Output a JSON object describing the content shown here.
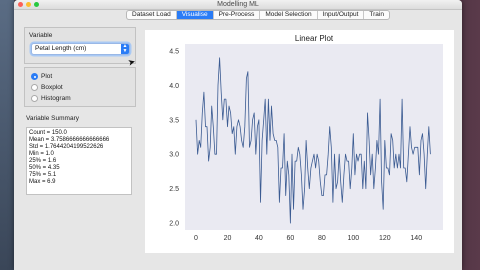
{
  "window": {
    "title": "Modelling ML"
  },
  "tabs": [
    {
      "label": "Dataset Load",
      "active": false
    },
    {
      "label": "Visualise",
      "active": true
    },
    {
      "label": "Pre-Process",
      "active": false
    },
    {
      "label": "Model Selection",
      "active": false
    },
    {
      "label": "Input/Output",
      "active": false
    },
    {
      "label": "Train",
      "active": false
    }
  ],
  "variable": {
    "label": "Variable",
    "selected": "Petal Length (cm)"
  },
  "plot_types": [
    {
      "label": "Plot",
      "checked": true
    },
    {
      "label": "Boxplot",
      "checked": false
    },
    {
      "label": "Histogram",
      "checked": false
    }
  ],
  "summary": {
    "label": "Variable Summary",
    "lines": [
      "Count = 150.0",
      "Mean = 3.7586666666666666",
      "Std = 1.764420419952262​6",
      "Min = 1.0",
      "25% = 1.6",
      "50% = 4.35",
      "75% = 5.1",
      "Max = 6.9"
    ]
  },
  "chart_data": {
    "type": "line",
    "title": "Linear Plot",
    "xlabel": "",
    "ylabel": "",
    "xlim": [
      -7,
      157
    ],
    "ylim": [
      1.9,
      4.6
    ],
    "xticks": [
      0,
      20,
      40,
      60,
      80,
      100,
      120,
      140
    ],
    "yticks": [
      2.0,
      2.5,
      3.0,
      3.5,
      4.0,
      4.5
    ],
    "grid": false,
    "color": "#3b5b92",
    "background": "#eaeaf2",
    "series": [
      {
        "values": [
          3.5,
          3.0,
          3.2,
          3.1,
          3.6,
          3.9,
          3.4,
          3.4,
          2.9,
          3.1,
          3.7,
          3.4,
          3.0,
          3.0,
          4.0,
          4.4,
          3.9,
          3.5,
          3.8,
          3.8,
          3.4,
          3.7,
          3.6,
          3.3,
          3.4,
          3.0,
          3.4,
          3.5,
          3.4,
          3.2,
          3.1,
          3.4,
          4.1,
          4.2,
          3.1,
          3.2,
          3.5,
          3.6,
          3.0,
          3.4,
          3.5,
          2.3,
          3.2,
          3.5,
          3.8,
          3.0,
          3.8,
          3.2,
          3.7,
          3.3,
          3.2,
          3.2,
          3.1,
          2.3,
          2.8,
          2.8,
          3.3,
          2.4,
          2.9,
          2.7,
          2.0,
          3.0,
          2.2,
          2.9,
          2.9,
          3.1,
          3.0,
          2.7,
          2.2,
          2.5,
          3.2,
          2.8,
          2.5,
          2.8,
          2.9,
          3.0,
          2.8,
          3.0,
          2.9,
          2.6,
          2.4,
          2.4,
          2.7,
          2.7,
          3.0,
          3.4,
          3.1,
          2.3,
          3.0,
          2.5,
          2.6,
          3.0,
          2.6,
          2.3,
          2.7,
          3.0,
          2.9,
          2.9,
          2.5,
          2.8,
          3.3,
          2.7,
          3.0,
          2.9,
          3.0,
          3.0,
          2.5,
          2.9,
          2.5,
          3.6,
          3.2,
          2.7,
          3.0,
          2.5,
          2.8,
          3.2,
          3.0,
          3.8,
          2.6,
          2.2,
          3.2,
          2.8,
          2.8,
          2.7,
          3.3,
          3.2,
          2.8,
          3.0,
          2.8,
          3.0,
          2.8,
          3.8,
          2.8,
          2.8,
          2.6,
          3.0,
          3.4,
          3.1,
          3.0,
          3.1,
          3.1,
          3.1,
          2.7,
          3.2,
          3.3,
          3.0,
          2.5,
          3.0,
          3.4,
          3.0
        ]
      }
    ]
  }
}
